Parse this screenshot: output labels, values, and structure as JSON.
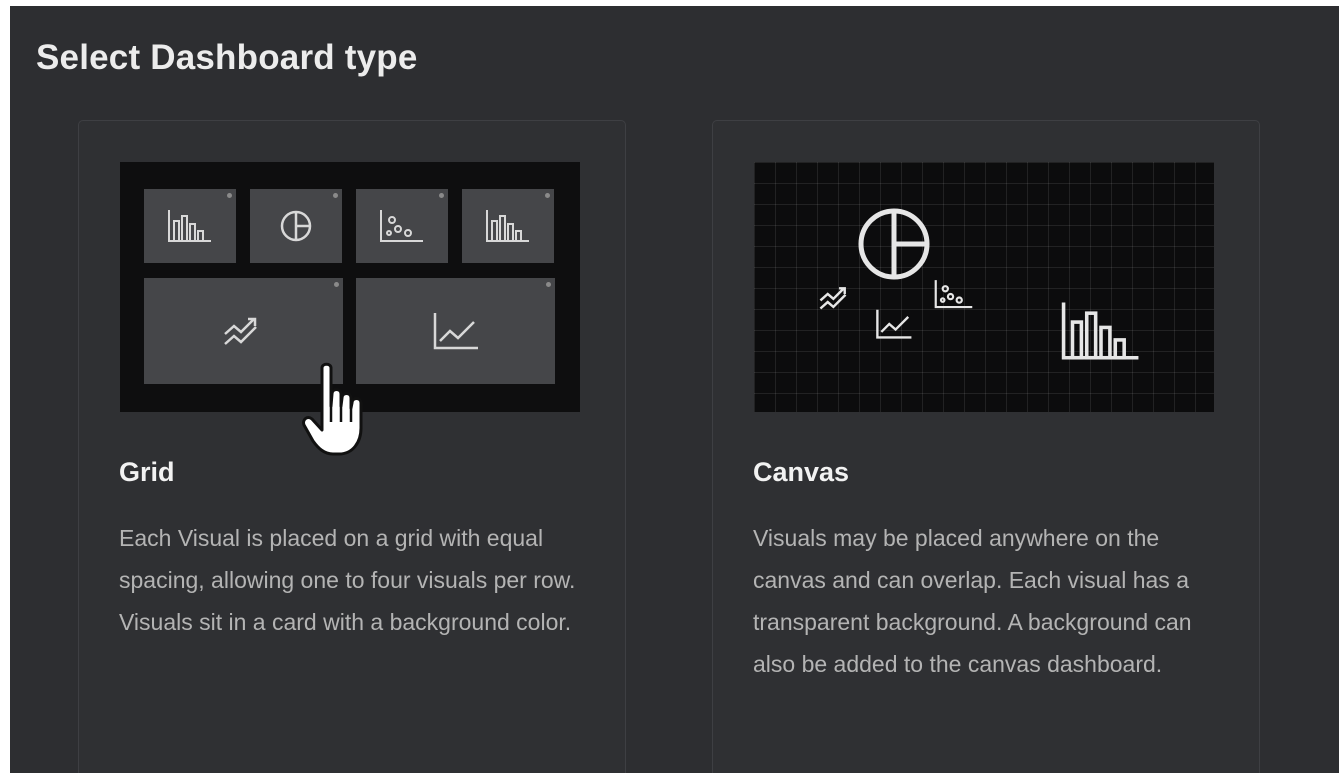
{
  "dialog": {
    "title": "Select Dashboard type"
  },
  "options": [
    {
      "title": "Grid",
      "description": "Each Visual is placed on a grid with equal spacing, allowing one to four visuals per row. Visuals sit in a card with a background color.",
      "preview_icons": [
        "bar-chart-icon",
        "pie-chart-icon",
        "scatter-chart-icon",
        "bar-chart-icon",
        "trend-icon",
        "line-chart-icon"
      ]
    },
    {
      "title": "Canvas",
      "description": "Visuals may be placed anywhere on the canvas and can overlap. Each visual has a transparent background. A background can also be added to the canvas dashboard.",
      "preview_icons": [
        "pie-chart-icon",
        "trend-icon",
        "line-chart-icon",
        "scatter-chart-icon",
        "bar-chart-icon"
      ]
    }
  ],
  "pointer": "hand-cursor-icon",
  "colors": {
    "panel_bg": "#2d2e31",
    "card_border": "#3e3f43",
    "tile_bg": "#454649",
    "text_primary": "#f2f2f2",
    "text_secondary": "#b4b4b4"
  }
}
